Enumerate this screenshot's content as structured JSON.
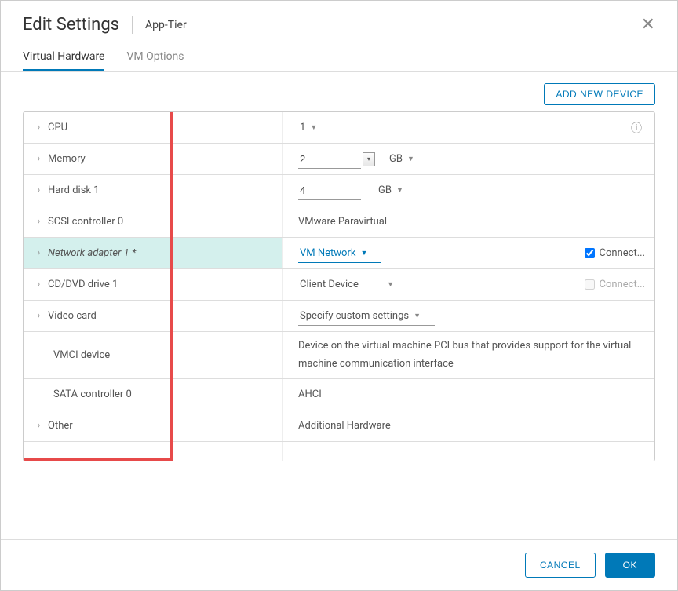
{
  "header": {
    "title": "Edit Settings",
    "subtitle": "App-Tier"
  },
  "tabs": {
    "hardware": "Virtual Hardware",
    "options": "VM Options"
  },
  "actions": {
    "add_device": "ADD NEW DEVICE"
  },
  "rows": {
    "cpu": {
      "label": "CPU",
      "value": "1"
    },
    "memory": {
      "label": "Memory",
      "value": "2",
      "unit": "GB"
    },
    "hdd": {
      "label": "Hard disk 1",
      "value": "4",
      "unit": "GB"
    },
    "scsi": {
      "label": "SCSI controller 0",
      "value": "VMware Paravirtual"
    },
    "net": {
      "label": "Network adapter 1 *",
      "value": "VM Network",
      "connect": "Connect..."
    },
    "cd": {
      "label": "CD/DVD drive 1",
      "value": "Client Device",
      "connect": "Connect..."
    },
    "video": {
      "label": "Video card",
      "value": "Specify custom settings"
    },
    "vmci": {
      "label": "VMCI device",
      "value": "Device on the virtual machine PCI bus that provides support for the virtual machine communication interface"
    },
    "sata": {
      "label": "SATA controller 0",
      "value": "AHCI"
    },
    "other": {
      "label": "Other",
      "value": "Additional Hardware"
    }
  },
  "footer": {
    "cancel": "CANCEL",
    "ok": "OK"
  }
}
